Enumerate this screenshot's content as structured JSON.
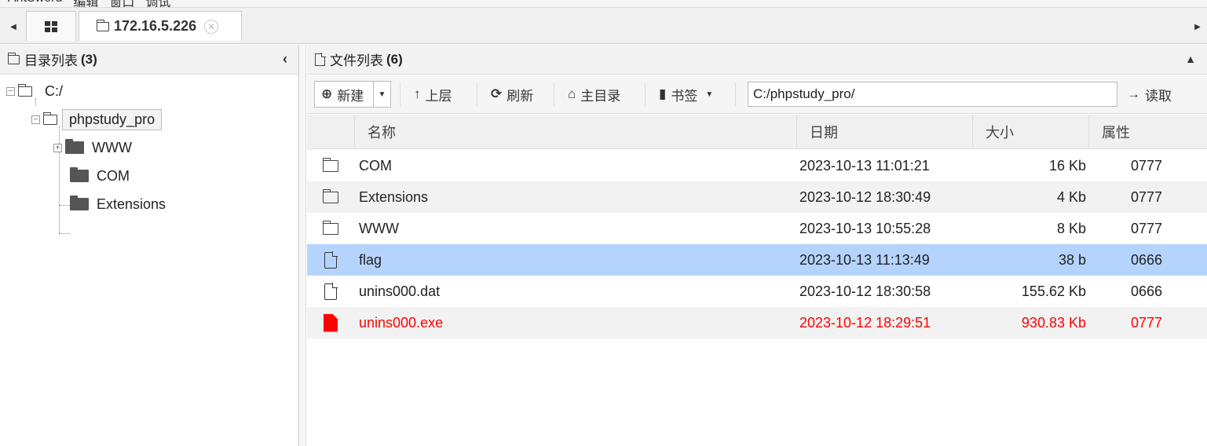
{
  "app": {
    "menu": [
      "AntSword",
      "编辑",
      "窗口",
      "调试"
    ]
  },
  "tabs": {
    "home_icon": "grid-icon",
    "session": {
      "label": "172.16.5.226",
      "icon": "folder-outline-icon"
    }
  },
  "left": {
    "title": "目录列表",
    "count": "(3)",
    "tree": {
      "root": "C:/",
      "child": "phpstudy_pro",
      "grandchildren": [
        "WWW",
        "COM",
        "Extensions"
      ]
    }
  },
  "right": {
    "title": "文件列表",
    "count": "(6)",
    "toolbar": {
      "new": "新建",
      "up": "上层",
      "refresh": "刷新",
      "home": "主目录",
      "bookmarks": "书签",
      "path": "C:/phpstudy_pro/",
      "read": "读取"
    },
    "columns": [
      "名称",
      "日期",
      "大小",
      "属性"
    ],
    "files": [
      {
        "name": "COM",
        "date": "2023-10-13 11:01:21",
        "size": "16 Kb",
        "attr": "0777",
        "type": "folder"
      },
      {
        "name": "Extensions",
        "date": "2023-10-12 18:30:49",
        "size": "4 Kb",
        "attr": "0777",
        "type": "folder"
      },
      {
        "name": "WWW",
        "date": "2023-10-13 10:55:28",
        "size": "8 Kb",
        "attr": "0777",
        "type": "folder"
      },
      {
        "name": "flag",
        "date": "2023-10-13 11:13:49",
        "size": "38 b",
        "attr": "0666",
        "type": "file",
        "selected": true
      },
      {
        "name": "unins000.dat",
        "date": "2023-10-12 18:30:58",
        "size": "155.62 Kb",
        "attr": "0666",
        "type": "file"
      },
      {
        "name": "unins000.exe",
        "date": "2023-10-12 18:29:51",
        "size": "930.83 Kb",
        "attr": "0777",
        "type": "file-red",
        "highlight_color": "#ff0000"
      }
    ]
  },
  "colors": {
    "selected_row": "#b5d4fd",
    "executable": "#ff0000"
  }
}
